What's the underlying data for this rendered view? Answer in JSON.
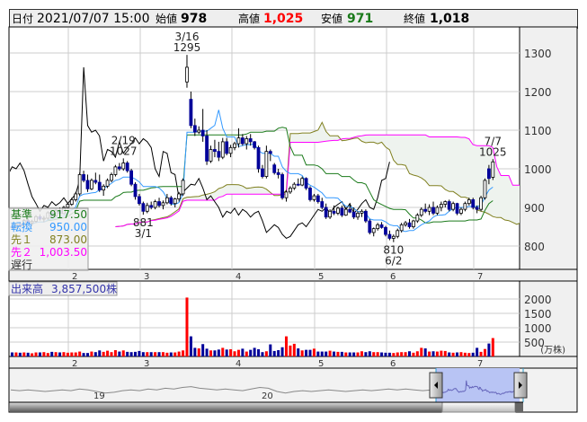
{
  "header": {
    "date_label": "日付",
    "date_value": "2021/07/07 15:00",
    "open_label": "始値",
    "open_value": "978",
    "high_label": "高値",
    "high_value": "1,025",
    "low_label": "安値",
    "low_value": "971",
    "close_label": "終値",
    "close_value": "1,018"
  },
  "legend": {
    "kijun_label": "基準",
    "kijun_value": "917.50",
    "tenkan_label": "転換",
    "tenkan_value": "950.00",
    "senkou1_label": "先１",
    "senkou1_value": "873.00",
    "senkou2_label": "先２",
    "senkou2_value": "1,003.50",
    "chikou_label": "遅行"
  },
  "volume_panel": {
    "label": "出来高",
    "value": "3,857,500株",
    "unit": "(万株)"
  },
  "navigator": {
    "labels": [
      "19",
      "20"
    ],
    "series": [
      62,
      61,
      62,
      61,
      60,
      61,
      62,
      61,
      63,
      62,
      60,
      58,
      59,
      61,
      62,
      61,
      63,
      62,
      64,
      63,
      65,
      66,
      64,
      63,
      62,
      63,
      62,
      61,
      63,
      65,
      64,
      60,
      58,
      60,
      61,
      60,
      61,
      62,
      61,
      60,
      61,
      62,
      61,
      62,
      63,
      62,
      63,
      62,
      61,
      62
    ]
  },
  "colors": {
    "up_candle": "#ffffff",
    "down_candle": "#000099",
    "up_volume": "#ff0000",
    "down_volume": "#000099",
    "kijun": "#1a7a1a",
    "tenkan": "#3399ff",
    "senkou1": "#808020",
    "senkou2": "#ff00ff",
    "chikou": "#000000",
    "cloud": "#eef3ee"
  },
  "chart_data": {
    "type": "candlestick",
    "title": "Ichimoku chart",
    "y_ticks": [
      1300,
      1200,
      1100,
      1000,
      900,
      800
    ],
    "ylim": [
      770,
      1360
    ],
    "x_ticks": [
      {
        "label": "2",
        "index": 15
      },
      {
        "label": "3",
        "index": 33
      },
      {
        "label": "4",
        "index": 56
      },
      {
        "label": "5",
        "index": 77
      },
      {
        "label": "6",
        "index": 95
      },
      {
        "label": "7",
        "index": 117
      }
    ],
    "volume_ticks": [
      2000,
      1500,
      1000,
      500
    ],
    "annotations": [
      {
        "date": "3/16",
        "value": "1295",
        "index": 44,
        "pos": "above"
      },
      {
        "date": "2/19",
        "value": "1027",
        "index": 28,
        "pos": "above"
      },
      {
        "date": "3/1",
        "value": "881",
        "index": 33,
        "pos": "below"
      },
      {
        "date": "6/2",
        "value": "810",
        "index": 96,
        "pos": "below"
      },
      {
        "date": "7/7",
        "value": "1025",
        "index": 121,
        "pos": "above"
      }
    ],
    "ohlc": [
      [
        850,
        858,
        842,
        848
      ],
      [
        848,
        860,
        845,
        856
      ],
      [
        856,
        862,
        848,
        852
      ],
      [
        852,
        870,
        850,
        866
      ],
      [
        866,
        872,
        858,
        860
      ],
      [
        860,
        868,
        852,
        864
      ],
      [
        864,
        880,
        860,
        876
      ],
      [
        876,
        882,
        866,
        870
      ],
      [
        870,
        878,
        862,
        872
      ],
      [
        872,
        890,
        868,
        886
      ],
      [
        886,
        892,
        874,
        878
      ],
      [
        878,
        896,
        876,
        892
      ],
      [
        892,
        900,
        880,
        884
      ],
      [
        884,
        904,
        882,
        900
      ],
      [
        900,
        912,
        896,
        908
      ],
      [
        908,
        925,
        904,
        920
      ],
      [
        920,
        940,
        915,
        935
      ],
      [
        935,
        990,
        930,
        985
      ],
      [
        985,
        995,
        965,
        970
      ],
      [
        970,
        985,
        940,
        948
      ],
      [
        948,
        975,
        945,
        970
      ],
      [
        970,
        990,
        960,
        965
      ],
      [
        965,
        985,
        940,
        945
      ],
      [
        945,
        960,
        930,
        955
      ],
      [
        955,
        975,
        950,
        970
      ],
      [
        970,
        990,
        965,
        985
      ],
      [
        985,
        1010,
        980,
        1005
      ],
      [
        1005,
        1015,
        995,
        1000
      ],
      [
        1000,
        1027,
        995,
        1015
      ],
      [
        1015,
        1020,
        990,
        995
      ],
      [
        995,
        1000,
        955,
        960
      ],
      [
        960,
        965,
        920,
        928
      ],
      [
        928,
        935,
        905,
        910
      ],
      [
        910,
        915,
        881,
        890
      ],
      [
        890,
        912,
        885,
        905
      ],
      [
        905,
        915,
        895,
        900
      ],
      [
        900,
        920,
        895,
        915
      ],
      [
        915,
        925,
        900,
        905
      ],
      [
        905,
        918,
        895,
        912
      ],
      [
        912,
        935,
        908,
        925
      ],
      [
        925,
        930,
        905,
        910
      ],
      [
        910,
        925,
        900,
        922
      ],
      [
        922,
        940,
        915,
        935
      ],
      [
        935,
        975,
        930,
        970
      ],
      [
        1225,
        1295,
        1210,
        1263
      ],
      [
        1180,
        1200,
        1105,
        1112
      ],
      [
        1112,
        1130,
        1085,
        1095
      ],
      [
        1095,
        1110,
        1090,
        1100
      ],
      [
        1100,
        1155,
        1070,
        1085
      ],
      [
        1085,
        1100,
        1010,
        1020
      ],
      [
        1020,
        1060,
        1015,
        1050
      ],
      [
        1050,
        1075,
        1030,
        1045
      ],
      [
        1045,
        1070,
        1020,
        1030
      ],
      [
        1030,
        1080,
        1025,
        1070
      ],
      [
        1070,
        1080,
        1035,
        1040
      ],
      [
        1040,
        1062,
        1030,
        1055
      ],
      [
        1055,
        1070,
        1048,
        1065
      ],
      [
        1065,
        1105,
        1055,
        1080
      ],
      [
        1080,
        1090,
        1060,
        1065
      ],
      [
        1065,
        1085,
        1050,
        1078
      ],
      [
        1078,
        1090,
        1060,
        1070
      ],
      [
        1070,
        1072,
        1050,
        1055
      ],
      [
        1055,
        1060,
        990,
        1000
      ],
      [
        1000,
        1010,
        975,
        980
      ],
      [
        980,
        1060,
        975,
        1045
      ],
      [
        1045,
        1050,
        1020,
        1040
      ],
      [
        1010,
        1015,
        985,
        990
      ],
      [
        990,
        1000,
        975,
        985
      ],
      [
        985,
        990,
        920,
        925
      ],
      [
        925,
        945,
        915,
        940
      ],
      [
        940,
        955,
        935,
        950
      ],
      [
        950,
        965,
        945,
        960
      ],
      [
        960,
        975,
        955,
        958
      ],
      [
        958,
        980,
        955,
        975
      ],
      [
        975,
        978,
        945,
        950
      ],
      [
        950,
        955,
        915,
        920
      ],
      [
        920,
        935,
        915,
        930
      ],
      [
        930,
        935,
        910,
        915
      ],
      [
        915,
        925,
        895,
        900
      ],
      [
        900,
        910,
        870,
        875
      ],
      [
        875,
        895,
        870,
        890
      ],
      [
        890,
        905,
        880,
        885
      ],
      [
        885,
        902,
        880,
        898
      ],
      [
        898,
        905,
        875,
        880
      ],
      [
        880,
        900,
        878,
        895
      ],
      [
        895,
        910,
        885,
        888
      ],
      [
        888,
        900,
        870,
        875
      ],
      [
        875,
        890,
        868,
        885
      ],
      [
        885,
        895,
        875,
        890
      ],
      [
        890,
        895,
        860,
        865
      ],
      [
        865,
        870,
        830,
        835
      ],
      [
        835,
        848,
        825,
        845
      ],
      [
        845,
        860,
        840,
        855
      ],
      [
        855,
        862,
        845,
        848
      ],
      [
        848,
        852,
        825,
        830
      ],
      [
        830,
        840,
        815,
        820
      ],
      [
        820,
        830,
        810,
        825
      ],
      [
        825,
        845,
        820,
        840
      ],
      [
        840,
        860,
        835,
        855
      ],
      [
        855,
        865,
        850,
        860
      ],
      [
        860,
        870,
        845,
        850
      ],
      [
        850,
        868,
        845,
        865
      ],
      [
        865,
        885,
        860,
        880
      ],
      [
        880,
        900,
        875,
        895
      ],
      [
        895,
        910,
        885,
        890
      ],
      [
        890,
        908,
        880,
        900
      ],
      [
        900,
        915,
        880,
        885
      ],
      [
        885,
        905,
        880,
        900
      ],
      [
        900,
        915,
        890,
        908
      ],
      [
        908,
        918,
        900,
        915
      ],
      [
        915,
        920,
        890,
        895
      ],
      [
        895,
        915,
        890,
        910
      ],
      [
        910,
        912,
        880,
        885
      ],
      [
        885,
        900,
        880,
        895
      ],
      [
        895,
        915,
        890,
        910
      ],
      [
        910,
        925,
        905,
        920
      ],
      [
        920,
        925,
        895,
        900
      ],
      [
        900,
        905,
        885,
        895
      ],
      [
        895,
        930,
        890,
        925
      ],
      [
        925,
        975,
        920,
        970
      ],
      [
        1000,
        1010,
        960,
        975
      ],
      [
        978,
        1025,
        971,
        1018
      ]
    ],
    "volume": [
      140,
      140,
      130,
      140,
      130,
      110,
      140,
      140,
      150,
      120,
      160,
      150,
      140,
      150,
      130,
      140,
      140,
      170,
      120,
      120,
      170,
      150,
      210,
      160,
      200,
      150,
      220,
      170,
      210,
      160,
      150,
      160,
      190,
      150,
      150,
      150,
      150,
      150,
      150,
      130,
      140,
      140,
      170,
      210,
      2050,
      700,
      300,
      280,
      430,
      270,
      210,
      210,
      240,
      300,
      240,
      250,
      180,
      230,
      270,
      170,
      230,
      300,
      250,
      150,
      180,
      420,
      190,
      220,
      320,
      700,
      380,
      440,
      280,
      210,
      230,
      230,
      270,
      170,
      170,
      170,
      200,
      170,
      160,
      160,
      140,
      140,
      140,
      140,
      180,
      150,
      180,
      150,
      150,
      140,
      130,
      130,
      120,
      140,
      150,
      150,
      180,
      130,
      180,
      300,
      280,
      170,
      180,
      170,
      200,
      190,
      140,
      130,
      140,
      150,
      130,
      120,
      130,
      300,
      160,
      260,
      450,
      640,
      550
    ]
  }
}
